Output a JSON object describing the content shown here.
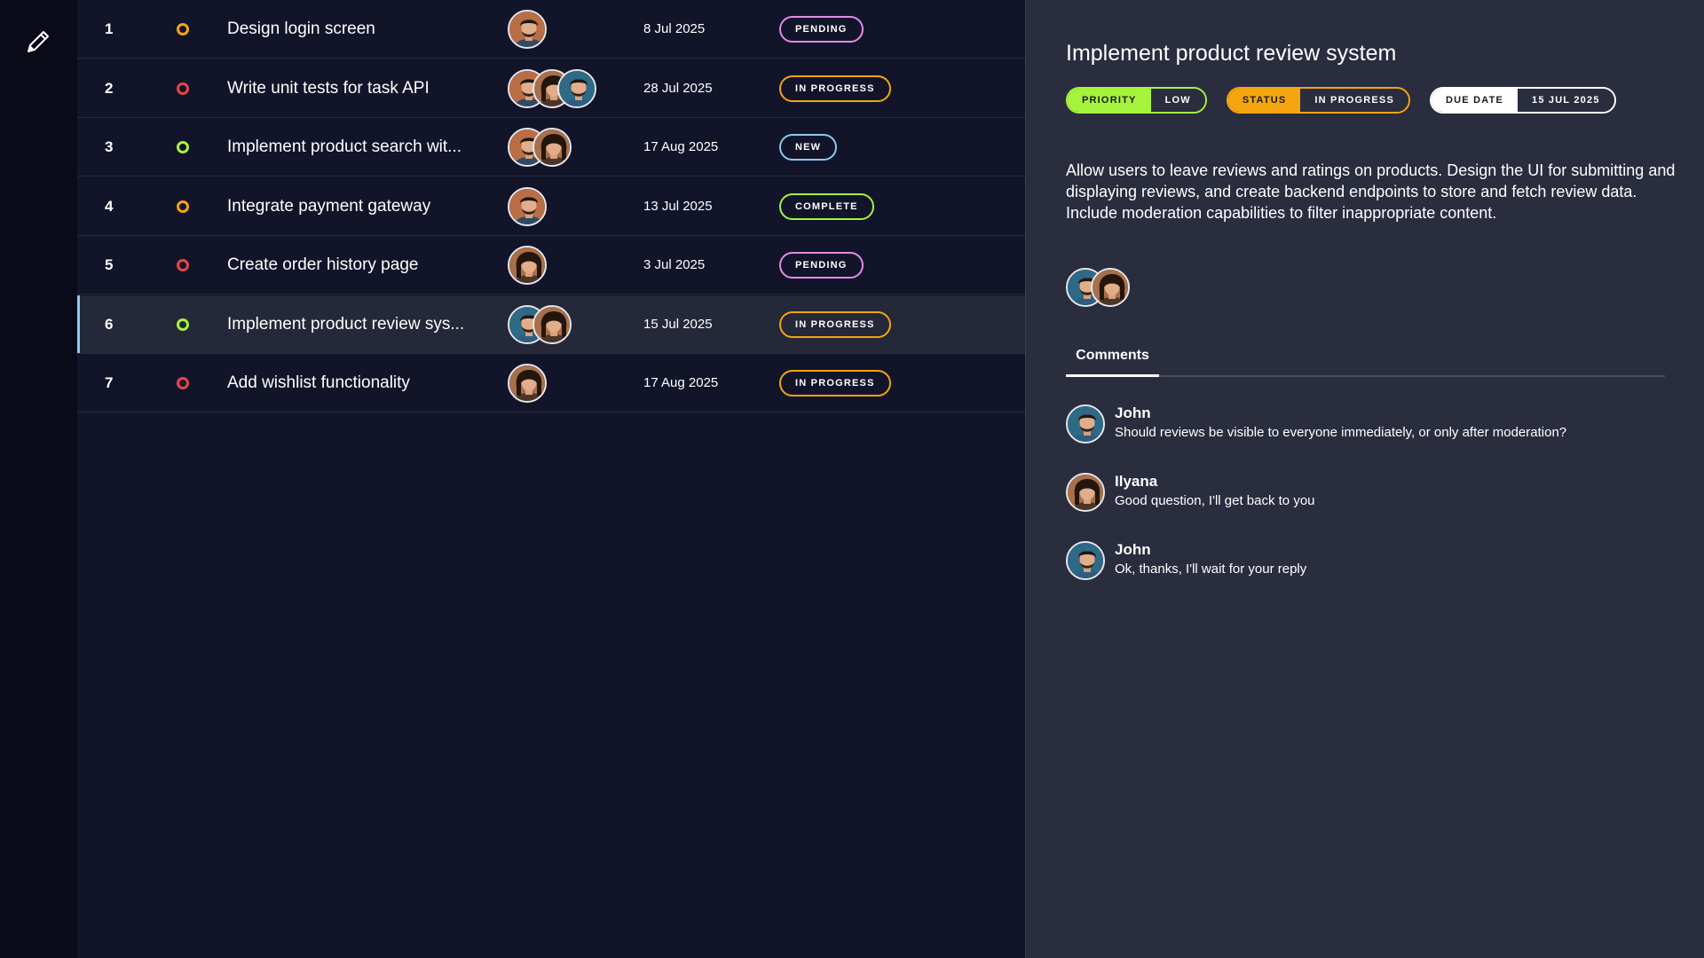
{
  "sidebar": {
    "edit_icon": "pencil-icon"
  },
  "tasks": [
    {
      "id": "1",
      "priority_color": "#f5a50f",
      "title": "Design login screen",
      "avatars": [
        "man-dark"
      ],
      "date": "8 Jul 2025",
      "status": "PENDING",
      "status_color": "#e58ae6"
    },
    {
      "id": "2",
      "priority_color": "#e64646",
      "title": "Write unit tests for task API",
      "avatars": [
        "man-dark",
        "woman",
        "man-blue"
      ],
      "date": "28 Jul 2025",
      "status": "IN PROGRESS",
      "status_color": "#f5a50f"
    },
    {
      "id": "3",
      "priority_color": "#a6f33d",
      "title": "Implement product search wit...",
      "avatars": [
        "man-dark",
        "woman"
      ],
      "date": "17 Aug 2025",
      "status": "NEW",
      "status_color": "#8fc8f0"
    },
    {
      "id": "4",
      "priority_color": "#f5a50f",
      "title": "Integrate payment gateway",
      "avatars": [
        "man-dark"
      ],
      "date": "13 Jul 2025",
      "status": "COMPLETE",
      "status_color": "#a6f33d"
    },
    {
      "id": "5",
      "priority_color": "#e64646",
      "title": "Create order history page",
      "avatars": [
        "woman"
      ],
      "date": "3 Jul 2025",
      "status": "PENDING",
      "status_color": "#e58ae6"
    },
    {
      "id": "6",
      "priority_color": "#a6f33d",
      "title": "Implement product review sys...",
      "avatars": [
        "man-blue",
        "woman"
      ],
      "date": "15 Jul 2025",
      "status": "IN PROGRESS",
      "status_color": "#f5a50f",
      "selected": true
    },
    {
      "id": "7",
      "priority_color": "#e64646",
      "title": "Add wishlist functionality",
      "avatars": [
        "woman"
      ],
      "date": "17 Aug 2025",
      "status": "IN PROGRESS",
      "status_color": "#f5a50f"
    }
  ],
  "detail": {
    "title": "Implement product review system",
    "priority_label": "PRIORITY",
    "priority_value": "LOW",
    "status_label": "STATUS",
    "status_value": "IN PROGRESS",
    "due_label": "DUE DATE",
    "due_value": "15 JUL 2025",
    "description": "Allow users to leave reviews and ratings on products. Design the UI for submitting and displaying reviews, and create backend endpoints to store and fetch review data. Include moderation capabilities to filter inappropriate content.",
    "assignees": [
      "man-blue",
      "woman"
    ],
    "tab_label": "Comments",
    "comments": [
      {
        "author": "John",
        "text": "Should reviews be visible to everyone immediately, or only after moderation?",
        "avatar": "man-blue"
      },
      {
        "author": "Ilyana",
        "text": "Good question, I'll get back to you",
        "avatar": "woman"
      },
      {
        "author": "John",
        "text": "Ok, thanks, I'll wait for your reply",
        "avatar": "man-blue"
      }
    ]
  },
  "colors": {
    "accent_green": "#a6f33d",
    "accent_orange": "#f5a50f",
    "accent_pink": "#e58ae6",
    "accent_blue": "#8fc8f0",
    "accent_red": "#e64646"
  }
}
